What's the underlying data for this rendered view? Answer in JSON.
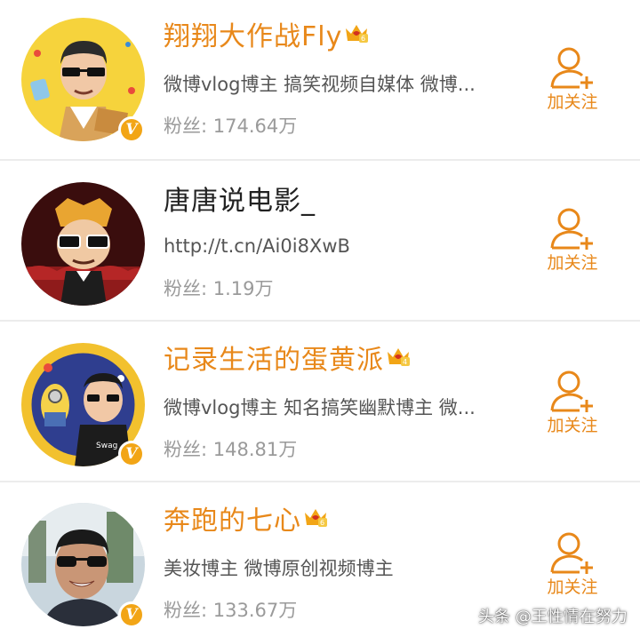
{
  "accent_color": "#e8881a",
  "users": [
    {
      "name": "翔翔大作战Fly",
      "name_style": "orange",
      "vip_level": "6",
      "verified": true,
      "description": "微博vlog博主 搞笑视频自媒体 微博...",
      "fans": "粉丝: 174.64万",
      "follow_label": "加关注"
    },
    {
      "name": "唐唐说电影_",
      "name_style": "dark",
      "vip_level": "",
      "verified": false,
      "description": "http://t.cn/Ai0i8XwB",
      "fans": "粉丝: 1.19万",
      "follow_label": "加关注"
    },
    {
      "name": "记录生活的蛋黄派",
      "name_style": "orange",
      "vip_level": "4",
      "verified": true,
      "description": "微博vlog博主 知名搞笑幽默博主 微...",
      "fans": "粉丝: 148.81万",
      "follow_label": "加关注"
    },
    {
      "name": "奔跑的七心",
      "name_style": "orange",
      "vip_level": "6",
      "verified": true,
      "description": "美妆博主 微博原创视频博主",
      "fans": "粉丝: 133.67万",
      "follow_label": "加关注"
    }
  ],
  "watermark": "头条 @王性情在努力"
}
